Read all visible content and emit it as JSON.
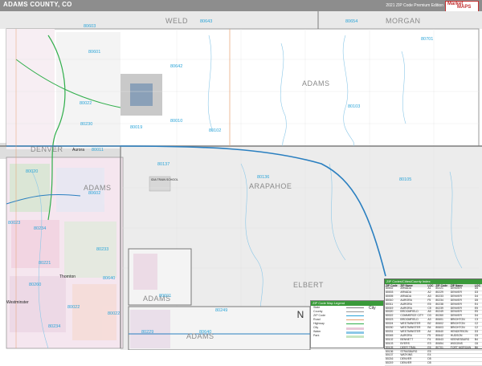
{
  "title": "ADAMS COUNTY, CO",
  "edition": "2021 ZIP Code Premium Edition",
  "logo": {
    "line1": "Market",
    "line2": "MAPS"
  },
  "counties": {
    "weld": "WELD",
    "morgan": "MORGAN",
    "adams_main": "ADAMS",
    "adams_west": "ADAMS",
    "adams_inset": "ADAMS",
    "adams_inset2": "ADAMS",
    "denver": "DENVER",
    "arapahoe": "ARAPAHOE",
    "elbert": "ELBERT"
  },
  "zips": [
    "80603",
    "80643",
    "80654",
    "80701",
    "80601",
    "80642",
    "80022",
    "80103",
    "80019",
    "80102",
    "80230",
    "80011",
    "80137",
    "80136",
    "80105",
    "80602",
    "80233",
    "80260",
    "80640",
    "80221",
    "80010",
    "80022",
    "80249",
    "80023",
    "80234",
    "80020",
    "80601",
    "80234",
    "80229",
    "80640",
    "80022"
  ],
  "cities": {
    "aurora": "Aurora",
    "westminster": "Westminster",
    "thornton": "Thornton",
    "city_label": "City",
    "school": "IDIA TRAIN SCHOOL"
  },
  "legend": {
    "title": "ZIP Code Map Legend",
    "rows": [
      "State",
      "County",
      "ZIP Code",
      "Road",
      "Highway",
      "City",
      "Water",
      "Park"
    ]
  },
  "ztable": {
    "title": "ZIP Codes/Cities/County Index",
    "headers": [
      "ZIP Code",
      "ZIP Name",
      "LOC",
      "ZIP Code",
      "ZIP Name",
      "LOC"
    ],
    "rows": [
      [
        "80002",
        "ARVADA",
        "A1",
        "80221",
        "DENVER",
        "D5"
      ],
      [
        "80003",
        "ARVADA",
        "A2",
        "80229",
        "DENVER",
        "D3"
      ],
      [
        "80005",
        "ARVADA",
        "A3",
        "80233",
        "DENVER",
        "D4"
      ],
      [
        "80010",
        "AURORA",
        "F5",
        "80234",
        "DENVER",
        "D5"
      ],
      [
        "80011",
        "AURORA",
        "E5",
        "80238",
        "DENVER",
        "E4"
      ],
      [
        "80019",
        "AURORA",
        "C5",
        "80239",
        "DENVER",
        "E5"
      ],
      [
        "80020",
        "BROOMFIELD",
        "A5",
        "80249",
        "DENVER",
        "E5"
      ],
      [
        "80022",
        "COMMERCE CITY",
        "D3",
        "80260",
        "DENVER",
        "D4"
      ],
      [
        "80023",
        "BROOMFIELD",
        "A3",
        "80601",
        "BRIGHTON",
        "C3"
      ],
      [
        "80024",
        "WESTMINSTER",
        "B2",
        "80602",
        "BRIGHTON",
        "C2"
      ],
      [
        "80030",
        "WESTMINSTER",
        "B4",
        "80603",
        "BRIGHTON",
        "C2"
      ],
      [
        "80031",
        "WESTMINSTER",
        "A4",
        "80640",
        "HENDERSON",
        "D3"
      ],
      [
        "80045",
        "AURORA",
        "F5",
        "80642",
        "HUDSON",
        "C5"
      ],
      [
        "80102",
        "BENNETT",
        "F4",
        "80643",
        "KEENESBURG",
        "B4"
      ],
      [
        "80103",
        "BYERS",
        "E3",
        "80654",
        "WIGGINS",
        "C6"
      ],
      [
        "80105",
        "DEER TRAIL",
        "E6",
        "80701",
        "FORT MORGAN",
        "B6"
      ],
      [
        "80136",
        "STRASBURG",
        "E5",
        "",
        "",
        ""
      ],
      [
        "80137",
        "WATKINS",
        "E4",
        "",
        "",
        ""
      ],
      [
        "80216",
        "DENVER",
        "D5",
        "",
        "",
        ""
      ],
      [
        "80219",
        "DENVER",
        "D5",
        "",
        "",
        ""
      ]
    ]
  },
  "compass": "N"
}
